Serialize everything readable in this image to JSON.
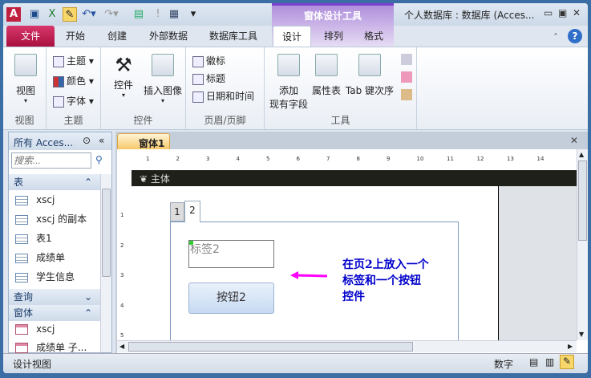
{
  "quick_access": [
    "save-icon",
    "excel-icon",
    "design-view-icon",
    "undo-icon",
    "redo-icon",
    "form-icon",
    "run-icon",
    "table-icon",
    "customize-icon"
  ],
  "context_tab_title": "窗体设计工具",
  "app_title": "个人数据库 : 数据库 (Acces...",
  "tabs": [
    "文件",
    "开始",
    "创建",
    "外部数据",
    "数据库工具",
    "设计",
    "排列",
    "格式"
  ],
  "ribbon": {
    "groups": [
      "视图",
      "主题",
      "控件",
      "页眉/页脚",
      "工具"
    ],
    "view": "视图",
    "theme_items": [
      "主题",
      "颜色",
      "字体"
    ],
    "controls": "控件",
    "insert_image": "插入图像",
    "header_items": [
      "徽标",
      "标题",
      "日期和时间"
    ],
    "add_field_1": "添加",
    "add_field_2": "现有字段",
    "property_sheet": "属性表",
    "tab_order": "Tab 键次序"
  },
  "nav": {
    "title": "所有 Acces...",
    "search_placeholder": "搜索...",
    "sections": [
      {
        "label": "表",
        "items": [
          "xscj",
          "xscj 的副本",
          "表1",
          "成绩单",
          "学生信息"
        ]
      },
      {
        "label": "查询",
        "items": []
      },
      {
        "label": "窗体",
        "items": [
          "xscj",
          "成绩单 子..."
        ]
      }
    ]
  },
  "document": {
    "tab": "窗体1",
    "section": "主体",
    "ruler": [
      "1",
      "2",
      "3",
      "4",
      "5",
      "6",
      "7",
      "8",
      "9",
      "10",
      "11",
      "12",
      "13",
      "14"
    ],
    "vruler": [
      "1",
      "2",
      "3",
      "4",
      "5"
    ],
    "tab_pages": [
      "1",
      "2"
    ],
    "label": "标签2",
    "button": "按钮2",
    "annotation": [
      "在页2上放入一个",
      "标签和一个按钮",
      "控件"
    ]
  },
  "status": {
    "left": "设计视图",
    "numlock": "数字"
  },
  "colors": {
    "file_tab": "#c0184c",
    "context": "#9a6cd6",
    "annotation": "#0000cc",
    "arrow": "#ff00ff"
  }
}
